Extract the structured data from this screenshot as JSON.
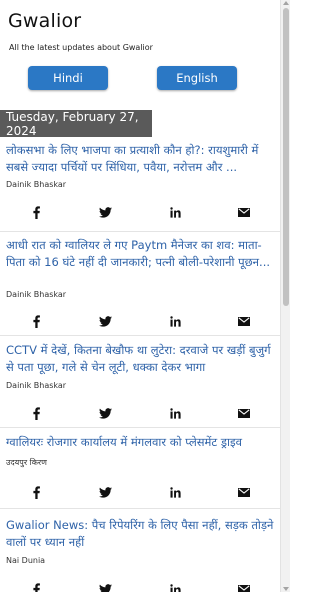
{
  "header": {
    "title": "Gwalior",
    "subtitle": "All the latest updates about Gwalior"
  },
  "language_buttons": {
    "hindi": "Hindi",
    "english": "English"
  },
  "date_label": "Tuesday, February 27, 2024",
  "articles": [
    {
      "headline": "लोकसभा के लिए भाजपा का प्रत्याशी कौन हो?: रायशुमारी में सबसे ज्यादा पर्चियों पर सिंधिया, पवैया, नरोत्तम और ...",
      "source": "Dainik Bhaskar"
    },
    {
      "headline": "आधी रात को ग्वालियर ले गए Paytm मैनेजर का शव: माता-पिता को 16 घंटे नहीं दी जानकारी; पत्नी बोली-परेशानी पूछन...",
      "source": "Dainik Bhaskar"
    },
    {
      "headline": "CCTV में देखें, कितना बेखौफ था लुटेरा: दरवाजे पर खड़ीं बुजुर्ग से पता पूछा, गले से चेन लूटी, धक्का देकर भागा",
      "source": "Dainik Bhaskar"
    },
    {
      "headline": "ग्वालियरः रोजगार कार्यालय में मंगलवार को प्लेसमेंट ड्राइव",
      "source": "उदयपुर किरण"
    },
    {
      "headline": "Gwalior News: पैच रिपेयरिंग के लिए पैसा नहीं, सड़क तोड़ने वालों पर ध्यान नहीं",
      "source": "Nai Dunia"
    }
  ],
  "share_icons": [
    "facebook-icon",
    "twitter-icon",
    "linkedin-icon",
    "email-icon"
  ],
  "colors": {
    "accent": "#2b78c5",
    "headline": "#2e62a8",
    "date_bar": "#5a5a5a"
  }
}
